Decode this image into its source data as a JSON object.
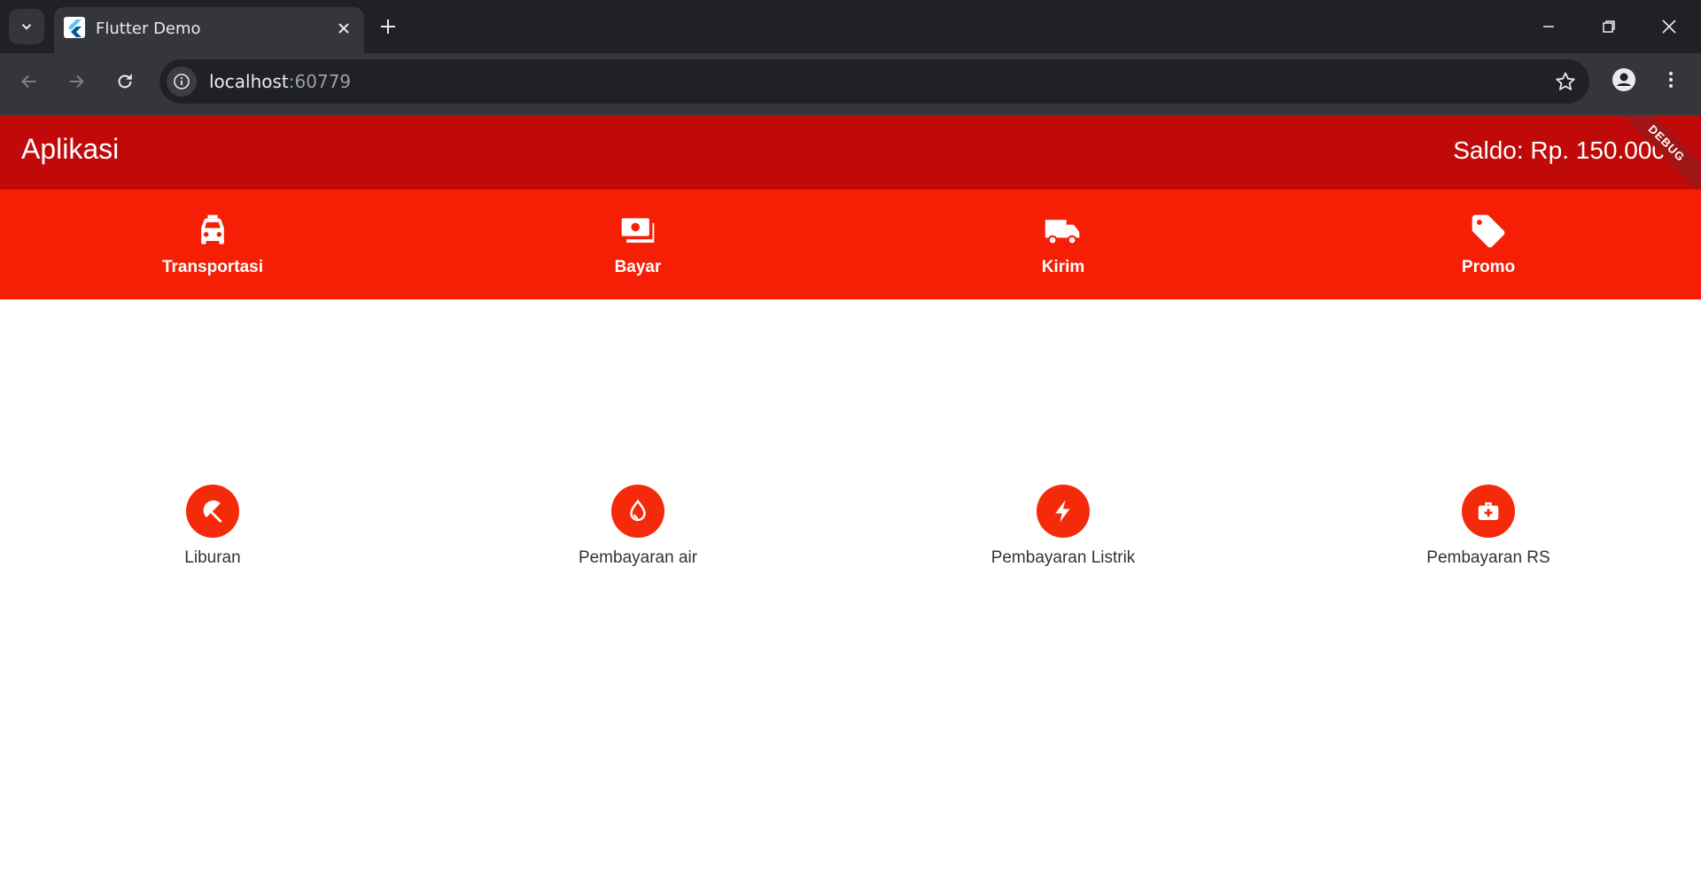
{
  "browser": {
    "tab_title": "Flutter Demo",
    "url_host": "localhost",
    "url_port": ":60779"
  },
  "appbar": {
    "title": "Aplikasi",
    "saldo": "Saldo: Rp. 150.000",
    "debug_banner": "DEBUG"
  },
  "tabs": [
    {
      "label": "Transportasi",
      "icon": "taxi-icon"
    },
    {
      "label": "Bayar",
      "icon": "payments-icon"
    },
    {
      "label": "Kirim",
      "icon": "truck-icon"
    },
    {
      "label": "Promo",
      "icon": "tag-icon"
    }
  ],
  "menu": [
    {
      "label": "Liburan",
      "icon": "beach-umbrella-icon"
    },
    {
      "label": "Pembayaran air",
      "icon": "water-drop-icon"
    },
    {
      "label": "Pembayaran Listrik",
      "icon": "lightning-icon"
    },
    {
      "label": "Pembayaran RS",
      "icon": "medical-kit-icon"
    }
  ],
  "colors": {
    "appbar": "#c00a0a",
    "tabbar": "#f61e05",
    "menu_circle": "#f52a0b"
  }
}
